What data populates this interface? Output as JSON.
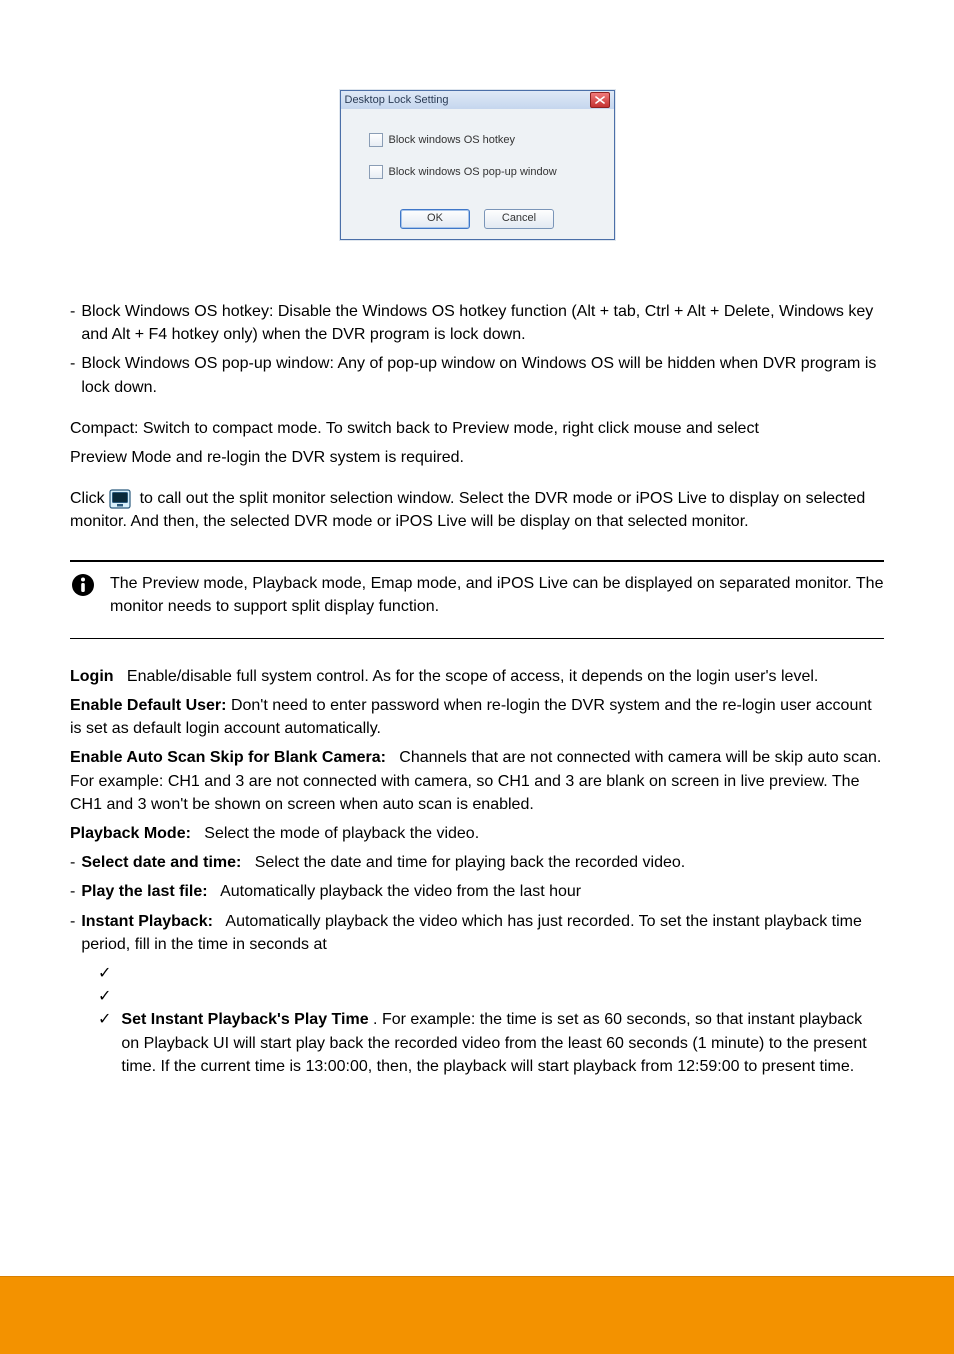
{
  "dialog": {
    "title": "Desktop Lock Setting",
    "option1": "Block windows OS hotkey",
    "option2": "Block windows OS pop-up window",
    "ok": "OK",
    "cancel": "Cancel"
  },
  "paras": {
    "p1_dash": "-",
    "p1": "Block Windows OS hotkey: Disable the Windows OS hotkey function (Alt + tab, Ctrl + Alt + Delete, Windows key and Alt + F4 hotkey only) when the DVR program is lock down.",
    "p2_dash": "-",
    "p2": "Block Windows OS pop-up window: Any of pop-up window on Windows OS will be hidden when DVR program is lock down.",
    "p3a": "Compact: Switch to compact mode. To switch back to Preview mode, right click mouse and select",
    "p3b": "Preview Mode and re-login the DVR system is required.",
    "p3icon_prefix": "Click "
  },
  "info": {
    "text": "The Preview mode, Playback mode, Emap mode, and iPOS Live can be displayed on separated monitor. The monitor needs to support split display function."
  },
  "lines": {
    "l_login": "Login",
    "l_login_tail": "Enable/disable full system control. As for the scope of access, it depends on the login user's level.",
    "l_default": "Enable Default User:",
    "l_default_tail1": "Don't need to enter password when",
    "l_default_tail2": " re-login the DVR system and the re-login user account is set as default login account automatically.",
    "l_enable": "Enable Auto Scan Skip for Blank Camera:",
    "l_enable_tail": "Channels that are not connected with camera will be skip auto scan. For example: CH1 and 3 are not connected with camera, so CH1 and 3 are blank on screen in live preview. ",
    "l_enable_tail2": "The CH1 and 3 won't be shown on screen when auto scan is enabled.",
    "l_pb": "Playback Mode:",
    "l_pb_tail": "Select the mode of playback the video.",
    "l_pb_dash": "-",
    "l_pb_opt1_head": "Select date and time:",
    "l_pb_opt1_tail": "Select the date and time for playing back the recorded video.",
    "l_pb_opt2_head": "Play the last file:",
    "l_pb_opt2_tail": "Automatically playback the video from the last hour",
    "l_pb_opt3_head": "Instant Playback:",
    "l_pb_opt3_tail1": "Automatically playback the video which has just recorded. To set the instant playback time period, fill in the time in seconds at ",
    "l_instant_bold": "Set Instant Playback's Play Time",
    "l_pb_opt3_tail2": ". For example: the time is set as 60 seconds, so that instant playback on Playback UI will start play back the recorded video from the least 60 seconds (1 minute) to the present time. If the current time is 13:00:00, then, the playback will start playback from 12:59:00 to present time."
  },
  "checks": {
    "mark": "✓"
  },
  "footer": {
    "text": ""
  }
}
